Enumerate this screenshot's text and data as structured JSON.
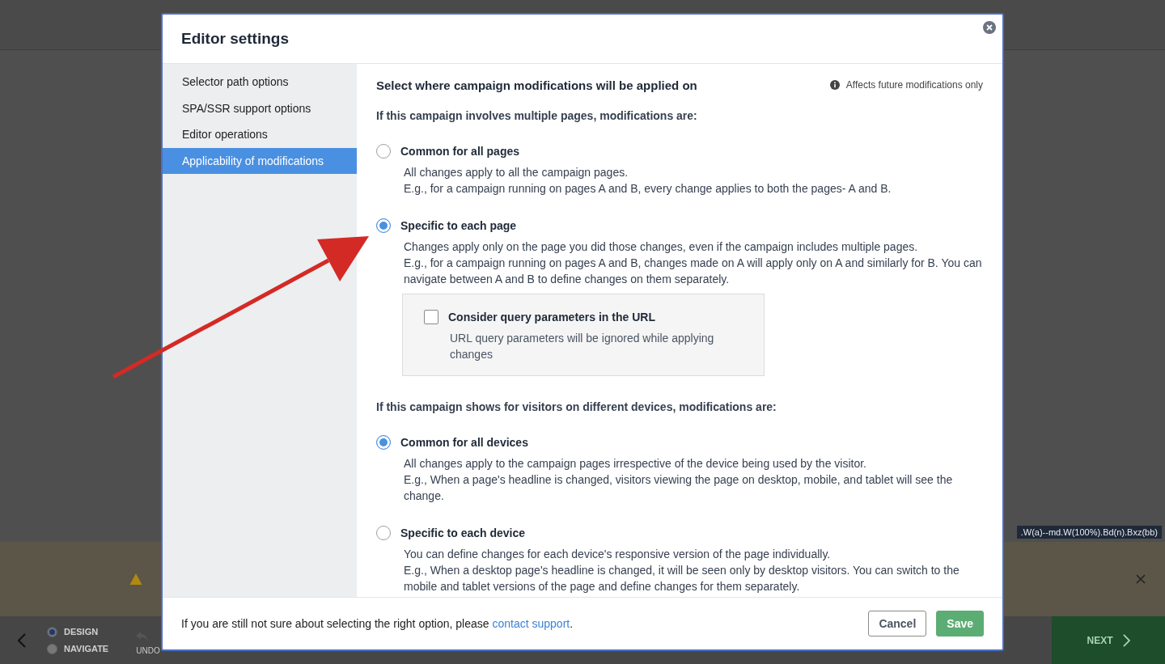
{
  "background": {
    "modes": [
      {
        "label": "DESIGN",
        "selected": true
      },
      {
        "label": "NAVIGATE",
        "selected": false
      }
    ],
    "undo": "UNDO",
    "next": "NEXT",
    "code_tip": ".W(a)--md.W(100%).Bd(n).Bxz(bb)"
  },
  "dialog": {
    "title": "Editor settings",
    "sidebar": [
      {
        "label": "Selector path options",
        "selected": false
      },
      {
        "label": "SPA/SSR support options",
        "selected": false
      },
      {
        "label": "Editor operations",
        "selected": false
      },
      {
        "label": "Applicability of modifications",
        "selected": true
      }
    ],
    "heading": "Select where campaign modifications will be applied on",
    "note": "Affects future modifications only",
    "sections": [
      {
        "question": "If this campaign involves multiple pages, modifications are:",
        "options": [
          {
            "label": "Common for all pages",
            "selected": false,
            "lines": [
              "All changes apply to all the campaign pages.",
              "E.g., for a campaign running on pages A and B, every change applies to both the pages- A and B."
            ]
          },
          {
            "label": "Specific to each page",
            "selected": true,
            "lines": [
              "Changes apply only on the page you did those changes, even if the campaign includes multiple pages.",
              "E.g., for a campaign running on pages A and B, changes made on A will apply only on A and similarly for B. You can navigate between A and B to define changes on them separately."
            ],
            "sub_option": {
              "label": "Consider query parameters in the URL",
              "checked": false,
              "description": "URL query parameters will be ignored while applying changes"
            }
          }
        ]
      },
      {
        "question": "If this campaign shows for visitors on different devices, modifications are:",
        "options": [
          {
            "label": "Common for all devices",
            "selected": true,
            "lines": [
              "All changes apply to the campaign pages irrespective of the device being used by the visitor.",
              "E.g., When a page's headline is changed, visitors viewing the page on desktop, mobile, and tablet will see the change."
            ]
          },
          {
            "label": "Specific to each device",
            "selected": false,
            "lines": [
              "You can define changes for each device's responsive version of the page individually.",
              "E.g., When a desktop page's headline is changed, it will be seen only by desktop visitors. You can switch to the mobile and tablet versions of the page and define changes for them separately."
            ]
          }
        ]
      }
    ],
    "footer": {
      "text": "If you are still not sure about selecting the right option, please ",
      "link": "contact support",
      "after": "."
    },
    "buttons": [
      {
        "label": "Cancel",
        "kind": "secondary"
      },
      {
        "label": "Save",
        "kind": "primary"
      }
    ]
  }
}
